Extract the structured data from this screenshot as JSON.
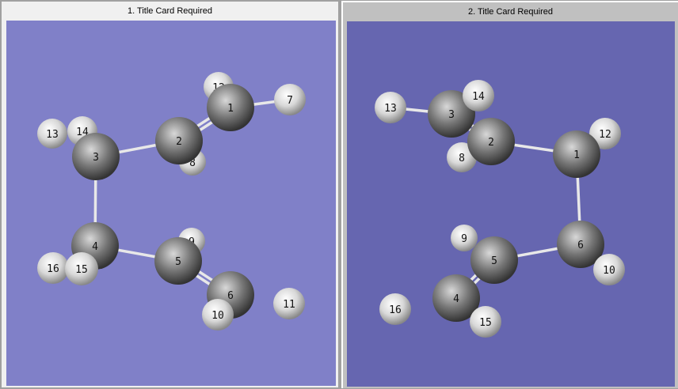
{
  "panels": [
    {
      "title": "1.  Title Card Required",
      "background": "#8080c8",
      "atoms": [
        "1",
        "2",
        "3",
        "4",
        "5",
        "6",
        "7",
        "8",
        "9",
        "10",
        "11",
        "12",
        "13",
        "14",
        "15",
        "16"
      ]
    },
    {
      "title": "2.  Title Card Required",
      "background": "#6666b0",
      "atoms": [
        "1",
        "2",
        "3",
        "4",
        "5",
        "6",
        "8",
        "9",
        "10",
        "12",
        "13",
        "14",
        "15",
        "16"
      ]
    }
  ]
}
